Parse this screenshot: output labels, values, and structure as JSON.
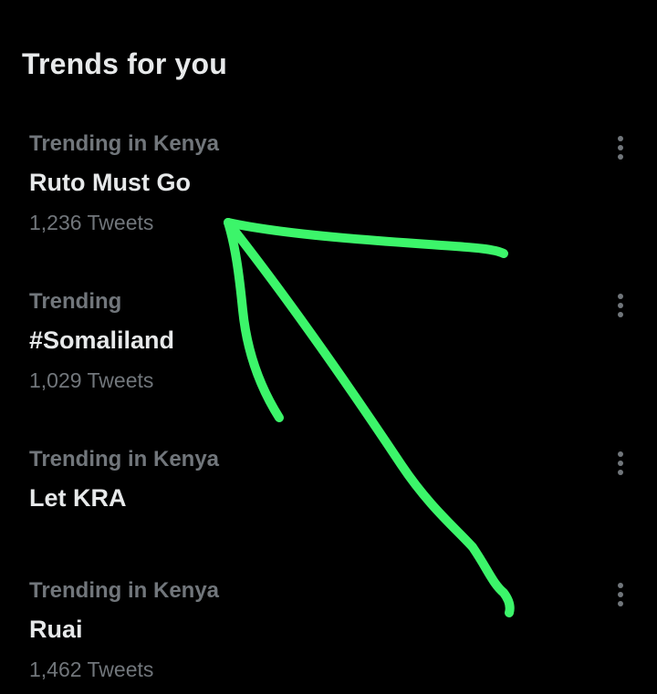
{
  "header": {
    "title": "Trends for you"
  },
  "trends": [
    {
      "context": "Trending in Kenya",
      "name": "Ruto Must Go",
      "count": "1,236 Tweets"
    },
    {
      "context": "Trending",
      "name": "#Somaliland",
      "count": "1,029 Tweets"
    },
    {
      "context": "Trending in Kenya",
      "name": "Let KRA"
    },
    {
      "context": "Trending in Kenya",
      "name": "Ruai",
      "count": "1,462 Tweets"
    }
  ],
  "icons": {
    "more": "more-vertical-icon"
  },
  "colors": {
    "background": "#000000",
    "primary_text": "#e7e9ea",
    "secondary_text": "#71767b",
    "annotation": "#3cf56a"
  }
}
